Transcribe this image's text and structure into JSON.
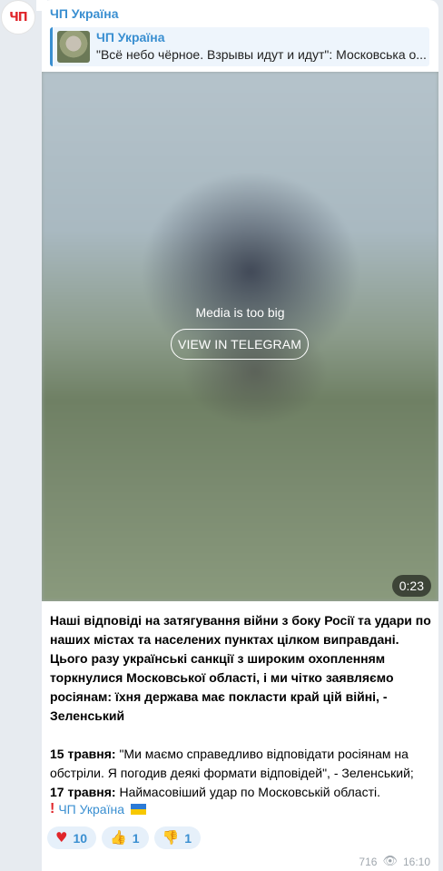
{
  "channel": {
    "avatar_text": "ЧП",
    "name": "ЧП Україна"
  },
  "reply": {
    "title": "ЧП Україна",
    "text": "\"Всё небо чёрное. Взрывы идут и идут\": Московська о..."
  },
  "media": {
    "notice": "Media is too big",
    "button_label": "VIEW IN TELEGRAM",
    "duration": "0:23"
  },
  "post": {
    "headline": "Наші відповіді на затягування війни з боку Росії та удари по наших містах та населених пунктах цілком виправдані. Цього разу українські санкції з широким охопленням торкнулися Московської області, і ми чітко заявляємо росіянам: їхня держава має покласти край цій війні, - Зеленський",
    "item1_date": "15 травня:",
    "item1_text": " \"Ми маємо справедливо відповідати росіянам на обстріли. Я погодив деякі формати відповідей\", - Зеленський;",
    "item2_date": "17 травня:",
    "item2_text": " Наймасовіший удар по Московській області.",
    "signature": "ЧП Україна"
  },
  "reactions": [
    {
      "icon": "heart-icon",
      "count": "10"
    },
    {
      "icon": "thumbs-up-icon",
      "count": "1"
    },
    {
      "icon": "thumbs-down-icon",
      "count": "1"
    }
  ],
  "meta": {
    "views": "716",
    "time": "16:10"
  },
  "colors": {
    "accent": "#3a8fd1",
    "bubble": "#ffffff",
    "background": "#e7ebf0",
    "reaction_bg": "#e6f0fa"
  }
}
